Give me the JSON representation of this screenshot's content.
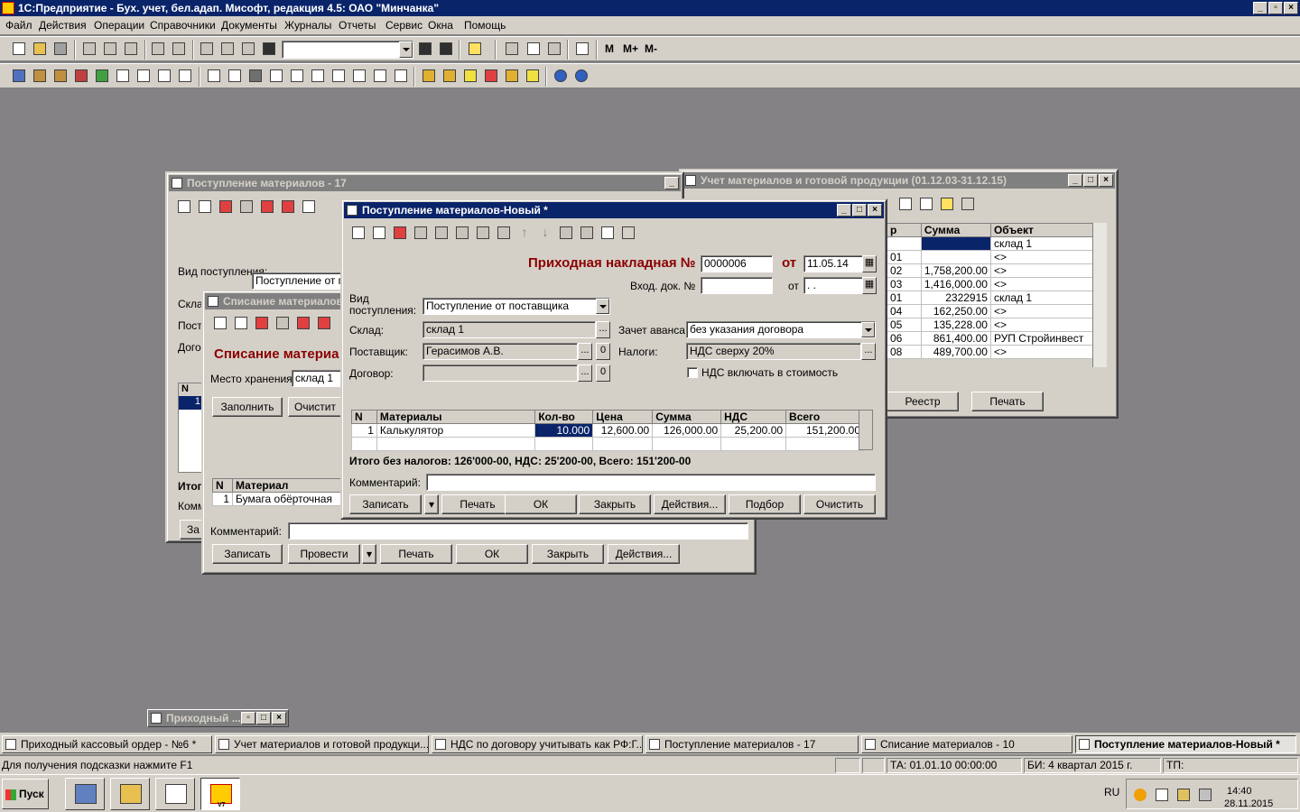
{
  "app": {
    "title": "1С:Предприятие - Бух. учет, бел.адап. Мисофт, редакция 4.5: ОАО \"Минчанка\""
  },
  "menu": [
    "Файл",
    "Действия",
    "Операции",
    "Справочники",
    "Документы",
    "Журналы",
    "Отчеты",
    "Сервис",
    "Окна",
    "Помощь"
  ],
  "toolbar": {
    "m_labels": [
      "M",
      "M+",
      "M-"
    ]
  },
  "win_journal": {
    "title": "Учет материалов и готовой продукции (01.12.03-31.12.15)",
    "headers": [
      "р",
      "Сумма",
      "Объект"
    ],
    "rows": [
      {
        "c0": "",
        "sum": "",
        "obj": "склад 1"
      },
      {
        "c0": "01",
        "sum": "",
        "obj": "<>"
      },
      {
        "c0": "02",
        "sum": "1,758,200.00",
        "obj": "<>"
      },
      {
        "c0": "03",
        "sum": "1,416,000.00",
        "obj": "<>"
      },
      {
        "c0": "01",
        "sum": "2322915",
        "obj": "склад 1"
      },
      {
        "c0": "04",
        "sum": "162,250.00",
        "obj": "<>"
      },
      {
        "c0": "05",
        "sum": "135,228.00",
        "obj": "<>"
      },
      {
        "c0": "06",
        "sum": "861,400.00",
        "obj": "РУП Стройинвест"
      },
      {
        "c0": "08",
        "sum": "489,700.00",
        "obj": "<>"
      }
    ],
    "btn_registry": "Реестр",
    "btn_print": "Печать"
  },
  "win_receipt17": {
    "title": "Поступление материалов - 17",
    "lbl_kind": "Вид поступления:",
    "kind_value": "Поступление от по",
    "lbl_warehouse": "Скла",
    "lbl_supplier": "Пост",
    "lbl_contract": "Дого",
    "col_n": "N",
    "row_n": "1",
    "lbl_total": "Итог",
    "lbl_comment": "Комм",
    "btn_partial": "За"
  },
  "win_writeoff": {
    "title": "Списание материалов",
    "heading": "Списание материа",
    "lbl_storage": "Место хранения:",
    "storage_value": "склад 1",
    "btn_fill": "Заполнить",
    "btn_clear": "Очистит",
    "col_n": "N",
    "col_material": "Материал",
    "row_n": "1",
    "row_material": "Бумага обёрточная",
    "lbl_comment": "Комментарий:",
    "btn_save": "Записать",
    "btn_post": "Провести",
    "btn_print": "Печать",
    "btn_ok": "ОК",
    "btn_close": "Закрыть",
    "btn_actions": "Действия..."
  },
  "win_new": {
    "title": "Поступление материалов-Новый *",
    "heading": "Приходная накладная №",
    "doc_number": "0000006",
    "lbl_from": "от",
    "doc_date": "11.05.14",
    "lbl_incoming": "Вход. док. №",
    "lbl_from2": "от",
    "incoming_date": " .  .",
    "lbl_kind": "Вид\nпоступления:",
    "kind_value": "Поступление от поставщика",
    "lbl_warehouse": "Склад:",
    "warehouse_value": "склад 1",
    "lbl_supplier": "Поставщик:",
    "supplier_value": "Герасимов А.В.",
    "lbl_contract": "Договор:",
    "contract_value": "",
    "lbl_advance": "Зачет аванса:",
    "advance_value": "без указания договора",
    "lbl_taxes": "Налоги:",
    "taxes_value": "НДС сверху 20%",
    "chk_vat_label": "НДС включать в стоимость",
    "chk_vat_checked": false,
    "table": {
      "headers": [
        "N",
        "Материалы",
        "Кол-во",
        "Цена",
        "Сумма",
        "НДС",
        "Всего"
      ],
      "rows": [
        {
          "n": "1",
          "material": "Калькулятор",
          "qty": "10.000",
          "price": "12,600.00",
          "sum": "126,000.00",
          "vat": "25,200.00",
          "total": "151,200.00"
        }
      ]
    },
    "summary": "Итого без налогов: 126'000-00, НДС: 25'200-00, Всего: 151'200-00",
    "lbl_comment": "Комментарий:",
    "comment_value": "",
    "btn_save": "Записать",
    "btn_print": "Печать",
    "btn_ok": "ОК",
    "btn_close": "Закрыть",
    "btn_actions": "Действия...",
    "btn_select": "Подбор",
    "btn_clear": "Очистить"
  },
  "minimized_window": "Приходный ...",
  "doc_tabs": [
    "Приходный кассовый ордер - №6 *",
    "Учет материалов и готовой продукци...",
    "НДС по договору учитывать как РФ:Г...",
    "Поступление материалов - 17",
    "Списание материалов - 10",
    "Поступление материалов-Новый *"
  ],
  "status": {
    "hint": "Для получения подсказки нажмите F1",
    "ta": "ТА: 01.01.10  00:00:00",
    "bi": "БИ: 4 квартал 2015 г.",
    "tp": "ТП:"
  },
  "taskbar": {
    "start": "Пуск",
    "lang": "RU",
    "time": "14:40",
    "date": "28.11.2015",
    "v7_label": "V7"
  }
}
